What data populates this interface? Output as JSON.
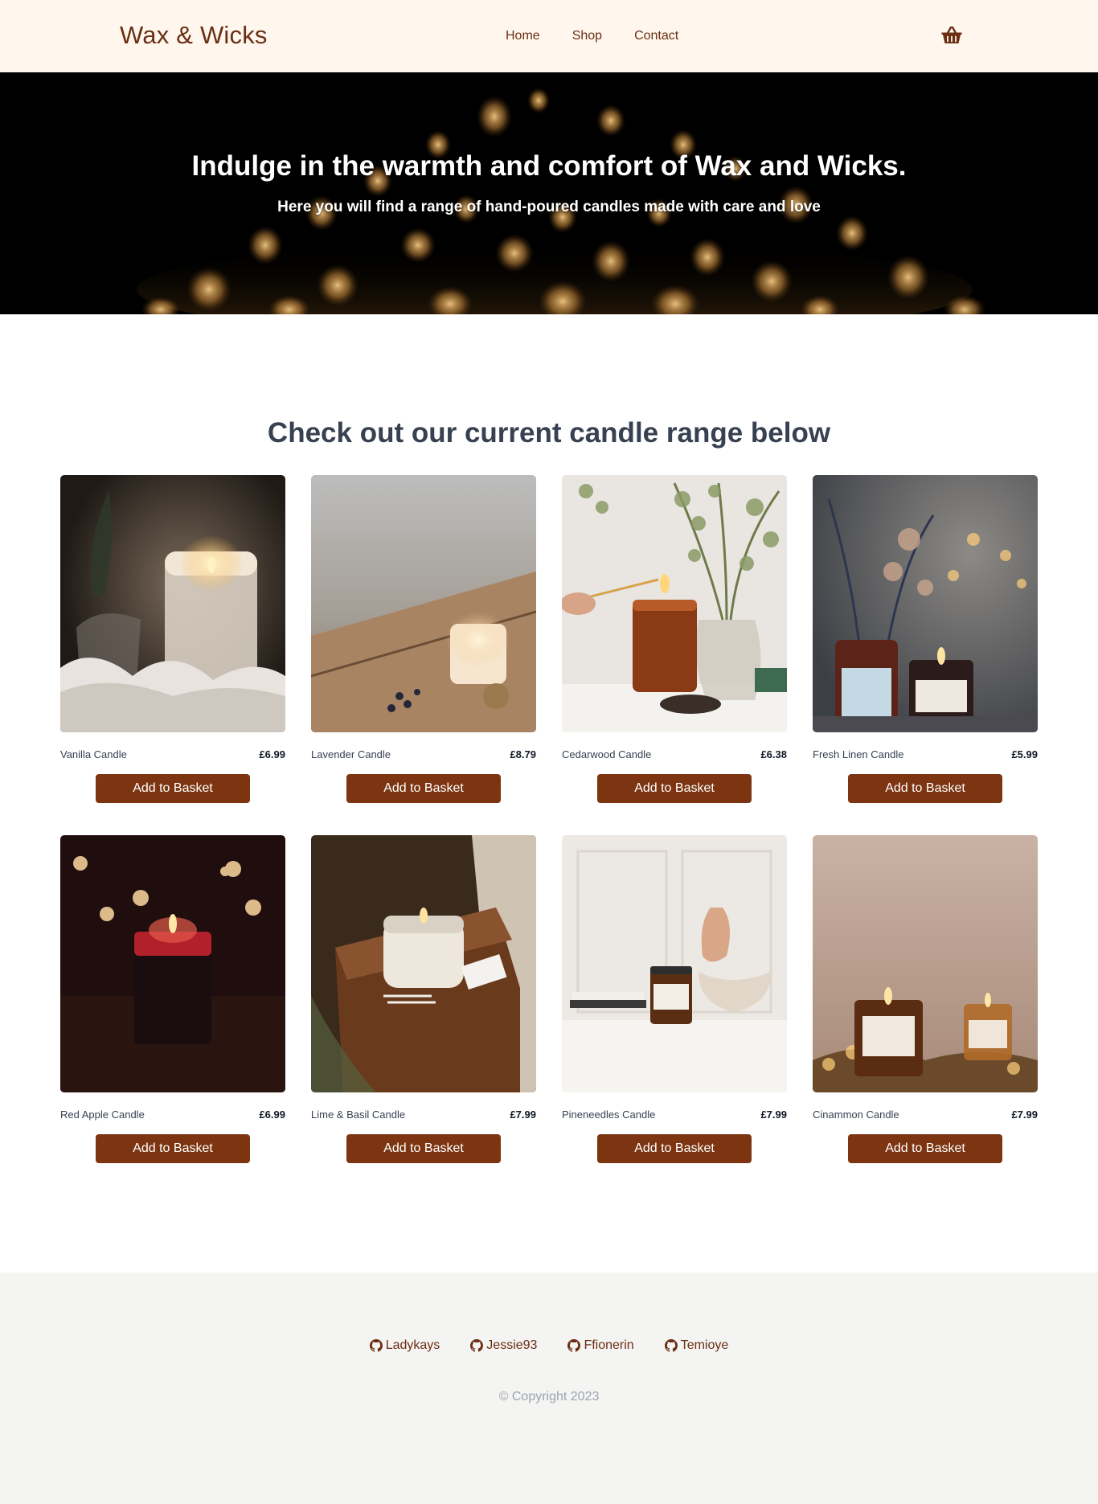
{
  "header": {
    "brand": "Wax & Wicks",
    "nav": [
      {
        "label": "Home"
      },
      {
        "label": "Shop"
      },
      {
        "label": "Contact"
      }
    ],
    "basket_icon": "basket-icon"
  },
  "hero": {
    "title": "Indulge in the warmth and comfort of Wax and Wicks.",
    "subtitle": "Here you will find a range of hand-poured candles made with care and love",
    "background": "candle-bokeh-image"
  },
  "products": {
    "title": "Check out our current candle range below",
    "button_label": "Add to Basket",
    "items": [
      {
        "name": "Vanilla Candle",
        "price": "£6.99"
      },
      {
        "name": "Lavender Candle",
        "price": "£8.79"
      },
      {
        "name": "Cedarwood Candle",
        "price": "£6.38"
      },
      {
        "name": "Fresh Linen Candle",
        "price": "£5.99"
      },
      {
        "name": "Red Apple Candle",
        "price": "£6.99"
      },
      {
        "name": "Lime & Basil Candle",
        "price": "£7.99"
      },
      {
        "name": "Pineneedles Candle",
        "price": "£7.99"
      },
      {
        "name": "Cinammon Candle",
        "price": "£7.99"
      }
    ]
  },
  "footer": {
    "links": [
      {
        "label": "Ladykays",
        "icon": "github-icon"
      },
      {
        "label": "Jessie93",
        "icon": "github-icon"
      },
      {
        "label": "Ffionerin",
        "icon": "github-icon"
      },
      {
        "label": "Temioye",
        "icon": "github-icon"
      }
    ],
    "copyright": "© Copyright 2023"
  },
  "colors": {
    "brand": "#6b2e13",
    "button": "#7c3510",
    "header_bg": "#fff7ee",
    "footer_bg": "#f4f4f2",
    "heading": "#374151"
  }
}
